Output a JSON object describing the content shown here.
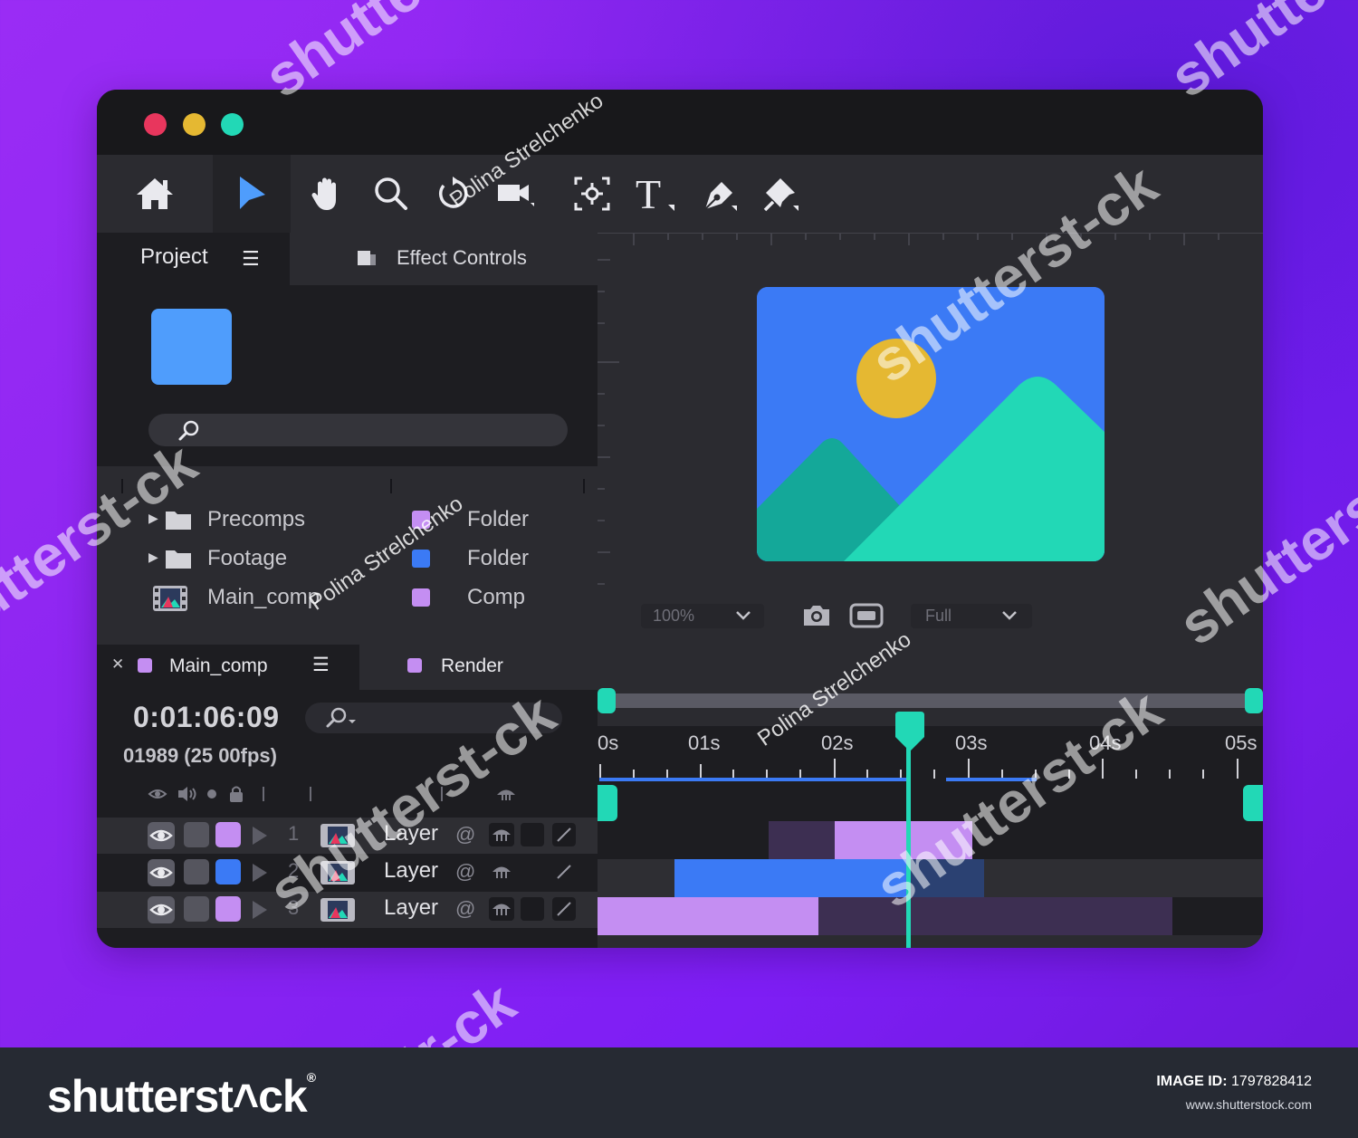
{
  "toolbar": {
    "tools": [
      "home-icon",
      "selection-tool-icon",
      "hand-tool-icon",
      "zoom-tool-icon",
      "rotate-tool-icon",
      "camera-tool-icon",
      "anchor-point-tool-icon",
      "type-tool-icon",
      "pen-tool-icon",
      "puppet-pin-tool-icon"
    ],
    "active_tool": "selection-tool-icon"
  },
  "project_panel": {
    "title": "Project",
    "menu_icon": "hamburger-icon",
    "effect_controls_label": "Effect Controls",
    "thumbnail_color": "#4f9dfc",
    "items": [
      {
        "name": "Precomps",
        "type": "Folder",
        "color": "#c48ef2",
        "icon": "folder-icon",
        "expandable": true
      },
      {
        "name": "Footage",
        "type": "Folder",
        "color": "#3b7af5",
        "icon": "folder-icon",
        "expandable": true
      },
      {
        "name": "Main_comp",
        "type": "Comp",
        "color": "#c48ef2",
        "icon": "composition-icon",
        "expandable": false
      }
    ]
  },
  "viewer": {
    "zoom": "100%",
    "resolution": "Full",
    "colors": {
      "sky": "#3b7af5",
      "sun": "#e5b832",
      "mountain_back": "#14a899",
      "mountain_front": "#22d8b6"
    }
  },
  "composition": {
    "tabs": [
      {
        "label": "Main_comp",
        "color": "#c48ef2"
      },
      {
        "label": "Render",
        "color": "#c48ef2"
      }
    ],
    "timecode": "0:01:06:09",
    "frames": "01989 (25 00fps)",
    "time_ruler": [
      "0s",
      "01s",
      "02s",
      "03s",
      "04s",
      "05s"
    ],
    "playhead_seconds": 2.35,
    "layers": [
      {
        "number": "1",
        "name": "Layer",
        "color": "#c48ef2"
      },
      {
        "number": "2",
        "name": "Layer",
        "color": "#3b7af5"
      },
      {
        "number": "3",
        "name": "Layer",
        "color": "#c48ef2"
      }
    ]
  },
  "accent_color": "#22d8b6",
  "watermark": {
    "brand": "shutterstock",
    "signature": "Polina Strelchenko",
    "image_id_label": "IMAGE ID:",
    "image_id": "1797828412",
    "url": "www.shutterstock.com"
  }
}
